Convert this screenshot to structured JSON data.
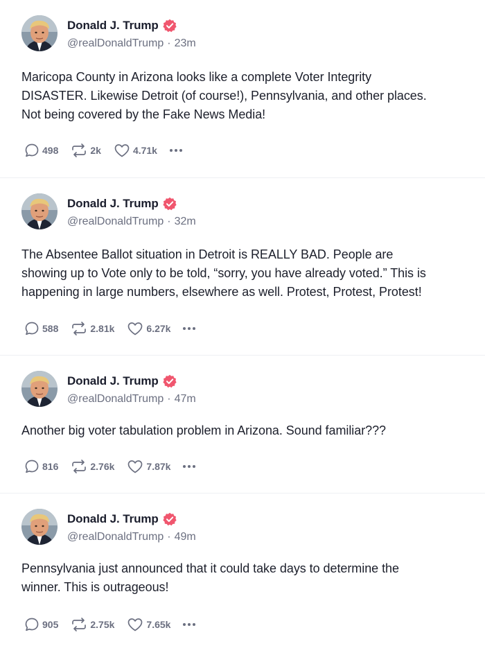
{
  "posts": [
    {
      "author": "Donald J. Trump",
      "handle": "@realDonaldTrump",
      "separator": "·",
      "time": "23m",
      "text": "Maricopa County in Arizona looks like a complete Voter Integrity\nDISASTER. Likewise Detroit (of course!), Pennsylvania, and other places.\nNot being covered by the Fake News Media!",
      "replies": "498",
      "reposts": "2k",
      "likes": "4.71k"
    },
    {
      "author": "Donald J. Trump",
      "handle": "@realDonaldTrump",
      "separator": "·",
      "time": "32m",
      "text": "The Absentee Ballot situation in Detroit is REALLY BAD. People are\nshowing up to Vote only to be told, “sorry, you have already voted.” This is\nhappening in large numbers, elsewhere as well. Protest, Protest, Protest!",
      "replies": "588",
      "reposts": "2.81k",
      "likes": "6.27k"
    },
    {
      "author": "Donald J. Trump",
      "handle": "@realDonaldTrump",
      "separator": "·",
      "time": "47m",
      "text": "Another big voter tabulation problem in Arizona. Sound familiar???",
      "replies": "816",
      "reposts": "2.76k",
      "likes": "7.87k"
    },
    {
      "author": "Donald J. Trump",
      "handle": "@realDonaldTrump",
      "separator": "·",
      "time": "49m",
      "text": "Pennsylvania just announced that it could take days to determine the\nwinner. This is outrageous!",
      "replies": "905",
      "reposts": "2.75k",
      "likes": "7.65k"
    }
  ],
  "colors": {
    "verified": "#f0566e",
    "text": "#1c1f2b",
    "muted": "#6b6f80",
    "divider": "#eef0f3"
  },
  "icons": {
    "avatar": "profile-photo",
    "verified": "verified-badge-icon",
    "reply": "speech-bubble-icon",
    "repost": "repost-arrows-icon",
    "like": "heart-icon",
    "more": "ellipsis-icon"
  }
}
